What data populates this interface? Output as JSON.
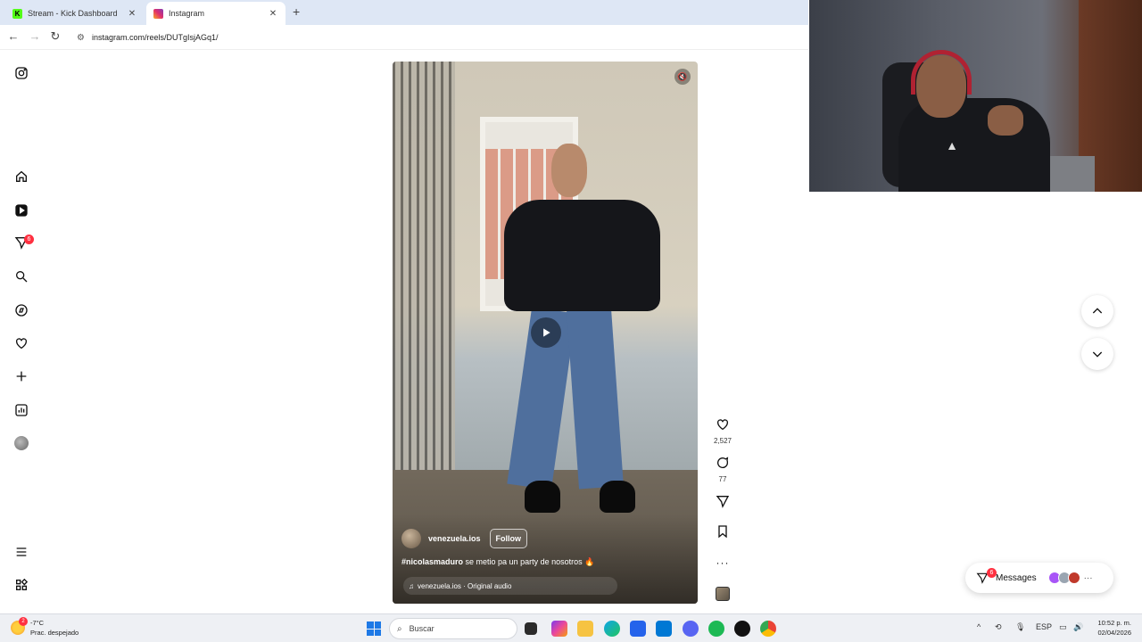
{
  "browser": {
    "tabs": [
      {
        "title": "Stream - Kick Dashboard",
        "favicon_color": "#53fc18",
        "favicon_text": "K"
      },
      {
        "title": "Instagram",
        "favicon_color": "#e1306c",
        "favicon_text": ""
      }
    ],
    "close_glyph": "✕",
    "new_tab_glyph": "+",
    "url": "instagram.com/reels/DUTgIsjAGq1/"
  },
  "sidebar": {
    "items": [
      "instagram-logo",
      "home-icon",
      "reels-icon",
      "messages-icon",
      "search-icon",
      "explore-icon",
      "notifications-icon",
      "create-icon",
      "dashboard-icon",
      "profile-avatar",
      "menu-icon",
      "more-apps-icon"
    ],
    "messages_badge": "6"
  },
  "reel": {
    "username": "venezuela.ios",
    "follow_label": "Follow",
    "caption_hashtag": "#nicolasmaduro",
    "caption_text": " se metio pa un party de nosotros 🔥",
    "audio_label": "venezuela.ios · Original audio",
    "likes": "2,527",
    "comments": "77",
    "more_glyph": "···"
  },
  "messages_pill": {
    "label": "Messages",
    "badge": "6",
    "more_glyph": "···"
  },
  "taskbar": {
    "weather_temp": "-7°C",
    "weather_desc": "Prac. despejado",
    "weather_badge": "2",
    "search_placeholder": "Buscar",
    "lang": "ESP",
    "time": "10:52 p. m.",
    "date": "02/04/2026"
  },
  "colors": {
    "accent_badge": "#ff3040",
    "windows_blue": "#1e79e6"
  }
}
